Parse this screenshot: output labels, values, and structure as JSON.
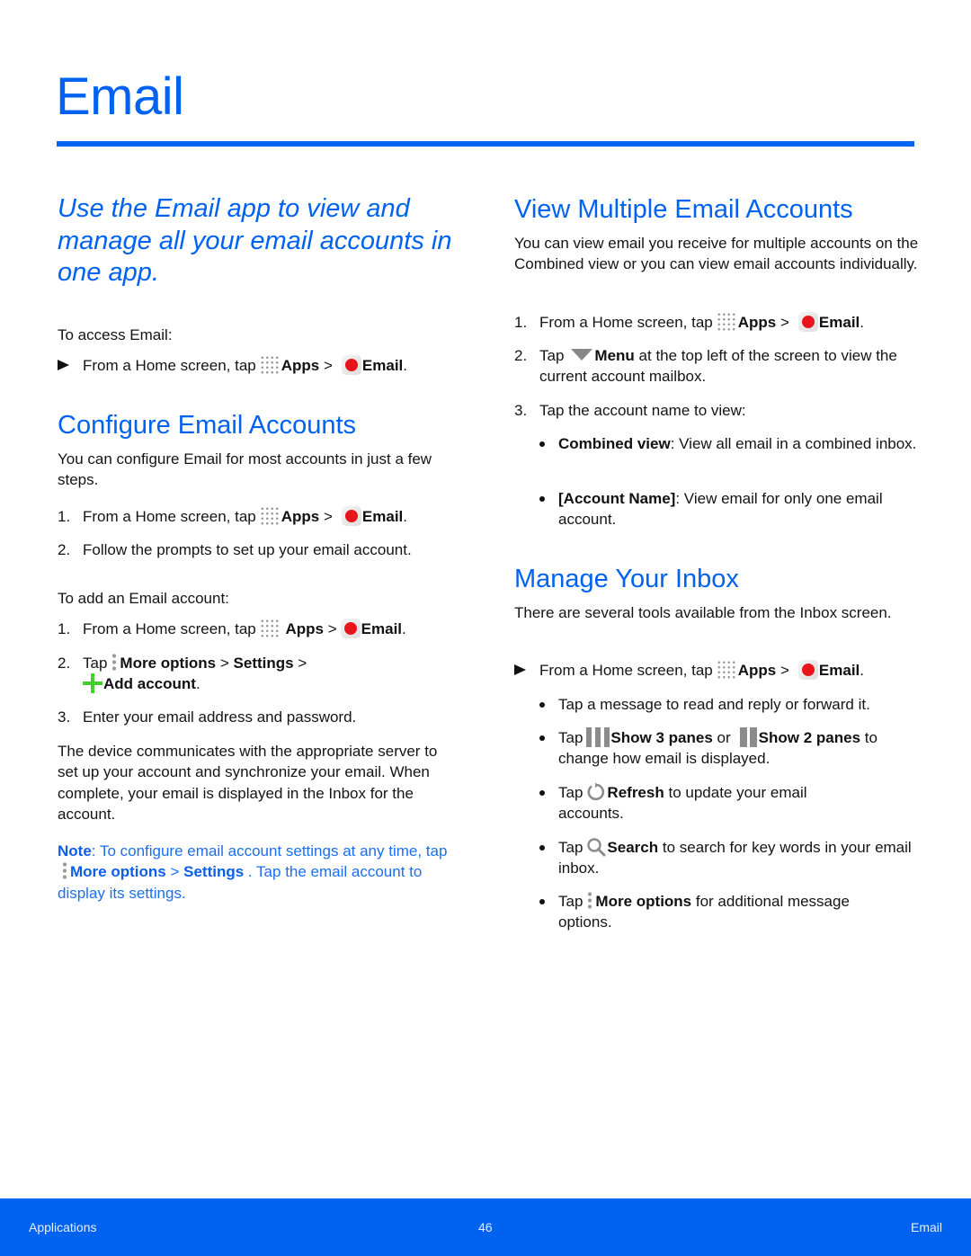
{
  "header": {
    "title": "Email"
  },
  "left": {
    "intro": "Use the Email app to view and manage all your email accounts in one app.",
    "access_label": "To access Email:",
    "access_step": {
      "prefix": "From a Home screen, tap",
      "apps": "Apps",
      "sep": ">",
      "email": "Email",
      "end": "."
    },
    "configure": {
      "heading": "Configure Email Accounts",
      "body": "You can configure Email for most accounts in just a few steps.",
      "steps": [
        {
          "num": "1.",
          "prefix": "From a Home screen, tap",
          "apps": "Apps",
          "sep": ">",
          "email": "Email",
          "end": "."
        },
        {
          "num": "2.",
          "text": "Follow the prompts to set up your email account."
        }
      ]
    },
    "add_account": {
      "label": "To add an Email account:",
      "steps": [
        {
          "num": "1.",
          "prefix": "From a Home screen, tap",
          "apps": "Apps",
          "sep": ">",
          "email": "Email",
          "end": "."
        },
        {
          "num": "2.",
          "tap": "Tap",
          "more_options": "More options",
          "sep1": ">",
          "settings": "Settings",
          "sep2": ">",
          "add_account": "Add account",
          "end": "."
        },
        {
          "num": "3.",
          "text": "Enter your email address and password."
        }
      ]
    },
    "device_para": "The device communicates with the appropriate server to set up your account and synchronize your email. When complete, your email is displayed in the Inbox for the account.",
    "note": {
      "label": "Note",
      "colon": ":",
      "text1": "To configure email account settings at any time, tap",
      "more_options": "More options",
      "sep": ">",
      "settings": "Settings",
      "text2": ". Tap the email account to display its settings."
    }
  },
  "right": {
    "view_multiple": {
      "heading": "View Multiple Email Accounts",
      "body": "You can view email you receive for multiple accounts on the Combined view or you can view email accounts individually.",
      "steps": [
        {
          "num": "1.",
          "prefix": "From a Home screen, tap",
          "apps": "Apps",
          "sep": ">",
          "email": "Email",
          "end": "."
        },
        {
          "num": "2.",
          "tap": "Tap",
          "menu": "Menu",
          "text": "at the top left of the screen to view the current account mailbox."
        },
        {
          "num": "3.",
          "text": "Tap the account name to view:"
        }
      ],
      "bullets": [
        {
          "bold": "Combined view",
          "text": ": View all email in a combined inbox."
        },
        {
          "bold": "[Account Name]",
          "text": ": View email for only one email account."
        }
      ]
    },
    "manage_inbox": {
      "heading": "Manage Your Inbox",
      "body": "There are several tools available from the Inbox screen.",
      "step": {
        "prefix": "From a Home screen, tap",
        "apps": "Apps",
        "sep": ">",
        "email": "Email",
        "end": "."
      },
      "bullets": [
        {
          "text": "Tap a message to read and reply or forward it."
        },
        {
          "tap": "Tap",
          "show3": "Show 3 panes",
          "or": "or",
          "show2": "Show 2 panes",
          "text": "to change how email is displayed."
        },
        {
          "tap": "Tap",
          "bold": "Refresh",
          "text": "to update your email accounts."
        },
        {
          "tap": "Tap",
          "bold": "Search",
          "text": "to search for key words in your email inbox."
        },
        {
          "tap": "Tap",
          "bold": "More options",
          "text": "for additional message options."
        }
      ]
    }
  },
  "footer": {
    "section": "Applications",
    "page": "46",
    "chapter": "Email"
  }
}
